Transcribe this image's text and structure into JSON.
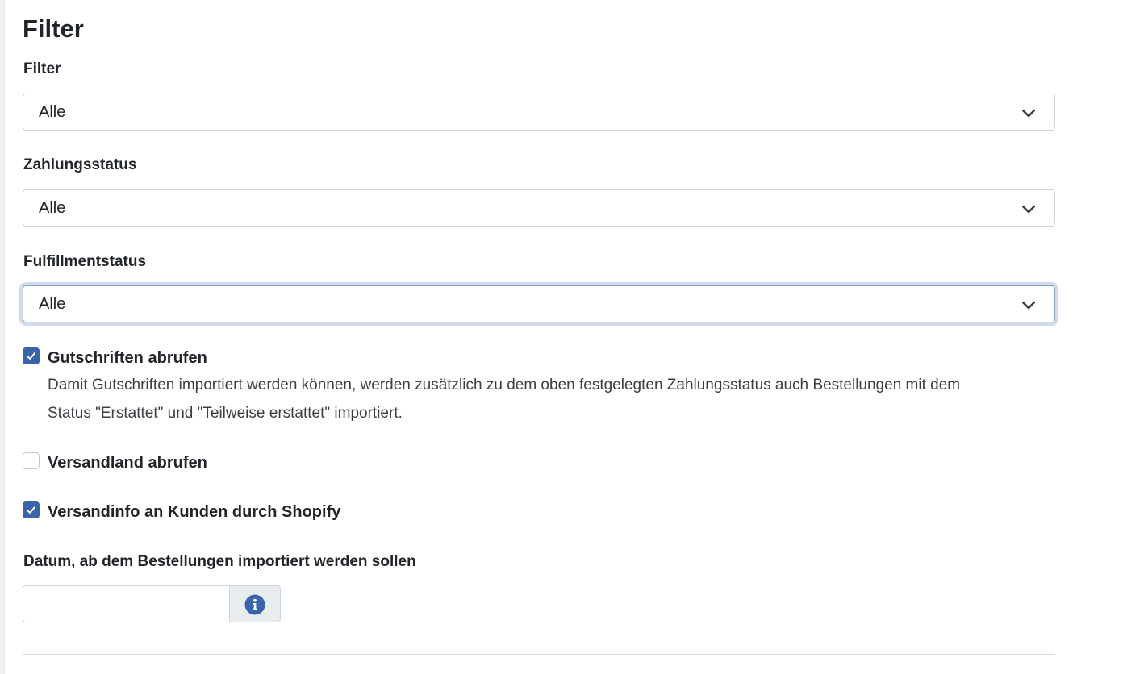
{
  "section": {
    "title": "Filter"
  },
  "filter": {
    "label": "Filter",
    "selected": "Alle"
  },
  "payment_status": {
    "label": "Zahlungsstatus",
    "selected": "Alle"
  },
  "fulfillment_status": {
    "label": "Fulfillmentstatus",
    "selected": "Alle"
  },
  "credit_notes": {
    "label": "Gutschriften abrufen",
    "checked": true,
    "help_line1": "Damit Gutschriften importiert werden können, werden zusätzlich zu dem oben festgelegten Zahlungsstatus auch Bestellungen mit dem",
    "help_line2": "Status \"Erstattet\" und \"Teilweise erstattet\" importiert."
  },
  "shipping_country": {
    "label": "Versandland abrufen",
    "checked": false
  },
  "shipping_info": {
    "label": "Versandinfo an Kunden durch Shopify",
    "checked": true
  },
  "import_date": {
    "label": "Datum, ab dem Bestellungen importiert werden sollen",
    "value": "",
    "info_icon": "info-circle-icon"
  },
  "colors": {
    "accent": "#3b63a8",
    "focus_ring": "#96afd2"
  }
}
